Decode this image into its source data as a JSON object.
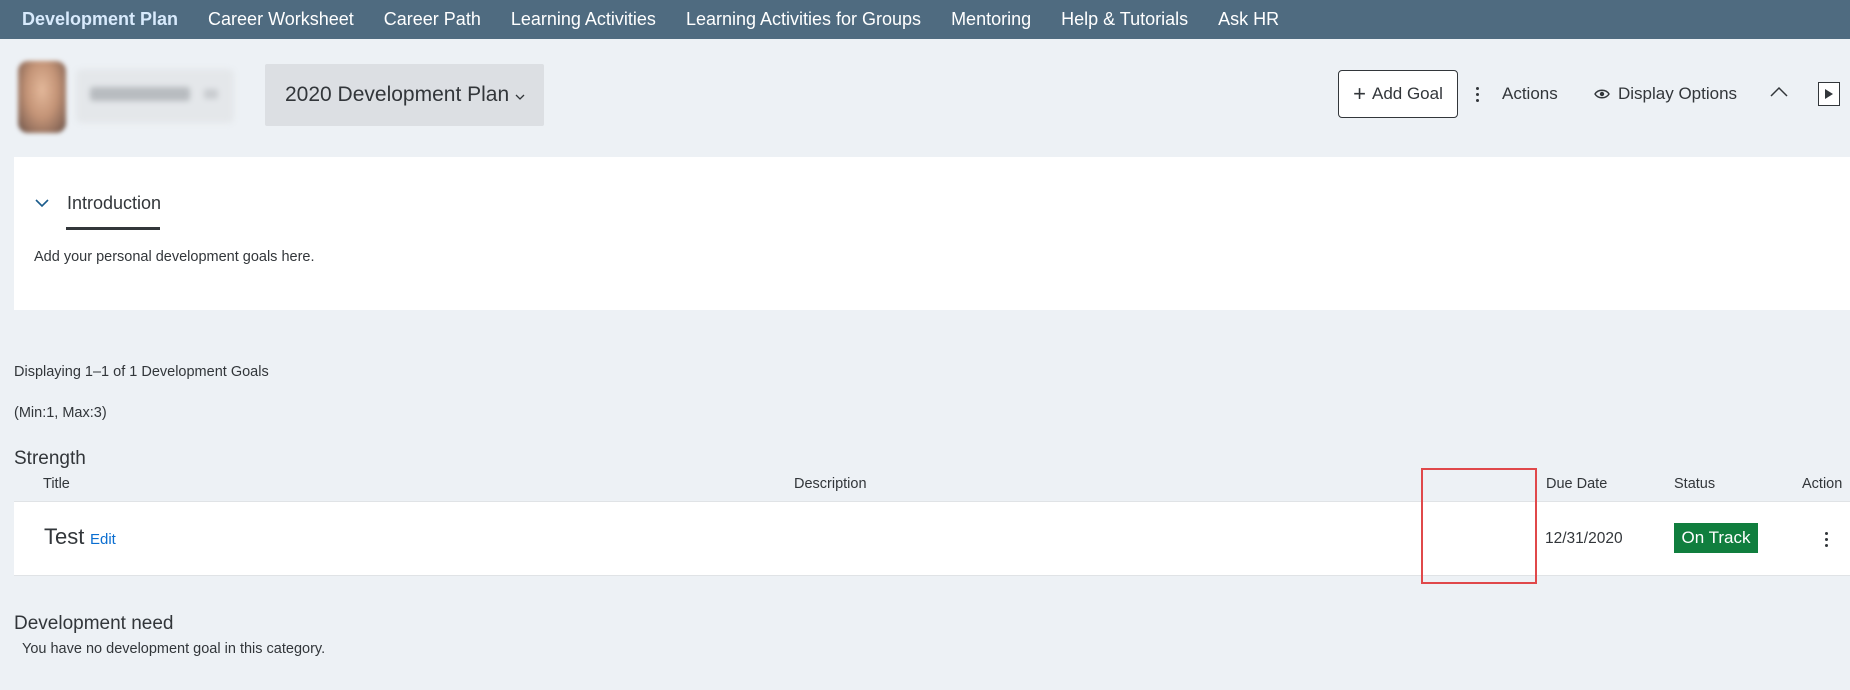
{
  "nav": {
    "items": [
      {
        "label": "Development Plan",
        "active": true
      },
      {
        "label": "Career Worksheet",
        "active": false
      },
      {
        "label": "Career Path",
        "active": false
      },
      {
        "label": "Learning Activities",
        "active": false
      },
      {
        "label": "Learning Activities for Groups",
        "active": false
      },
      {
        "label": "Mentoring",
        "active": false
      },
      {
        "label": "Help & Tutorials",
        "active": false
      },
      {
        "label": "Ask HR",
        "active": false
      }
    ]
  },
  "header": {
    "plan_selector": "2020 Development Plan",
    "add_goal_label": "Add Goal",
    "actions_label": "Actions",
    "display_options_label": "Display Options"
  },
  "intro": {
    "title": "Introduction",
    "text": "Add your personal development goals here."
  },
  "goals": {
    "count_text": "Displaying 1–1 of 1 Development Goals",
    "minmax_text": "(Min:1, Max:3)",
    "columns": {
      "title": "Title",
      "description": "Description",
      "due_date": "Due Date",
      "status": "Status",
      "action": "Action"
    },
    "categories": [
      {
        "name": "Strength",
        "rows": [
          {
            "title": "Test",
            "edit_label": "Edit",
            "description": "",
            "due_date": "12/31/2020",
            "status": "On Track"
          }
        ]
      },
      {
        "name": "Development need",
        "empty_text": "You have no development goal in this category."
      }
    ]
  },
  "colors": {
    "nav_bg": "#4f6b80",
    "page_bg": "#edf1f5",
    "status_on_track": "#107e3e",
    "link": "#0a6ed1",
    "highlight": "#e0484a"
  },
  "icons": {
    "plan_chevron": "chevron-down-icon",
    "add": "plus-icon",
    "actions": "vertical-dots-icon",
    "display": "eye-icon",
    "collapse": "chevron-up-icon",
    "play": "play-icon",
    "intro_toggle": "chevron-down-icon",
    "row_menu": "vertical-dots-icon"
  }
}
